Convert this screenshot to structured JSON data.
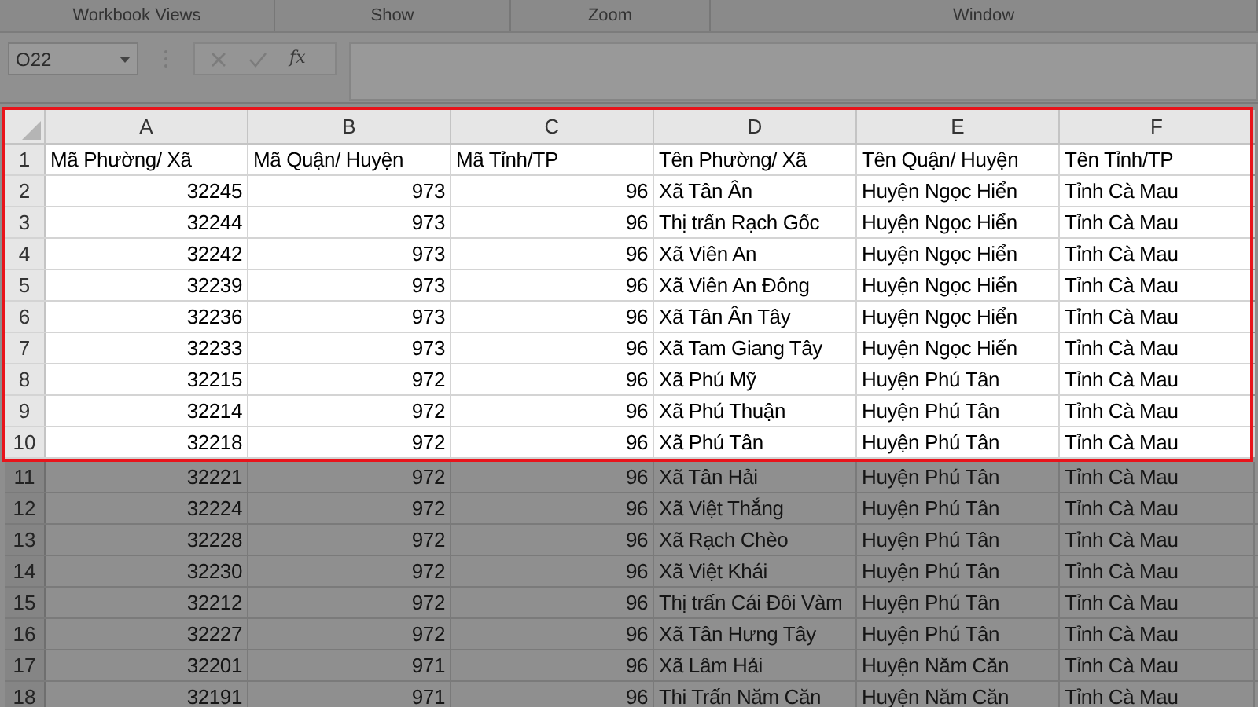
{
  "ribbon_groups": [
    "Workbook Views",
    "Show",
    "Zoom",
    "Window"
  ],
  "name_box": {
    "value": "O22"
  },
  "insert_function": "fx",
  "columns": [
    {
      "label": "A",
      "kind": "number"
    },
    {
      "label": "B",
      "kind": "number"
    },
    {
      "label": "C",
      "kind": "number"
    },
    {
      "label": "D",
      "kind": "text"
    },
    {
      "label": "E",
      "kind": "text"
    },
    {
      "label": "F",
      "kind": "text"
    }
  ],
  "rows": [
    {
      "number": "1",
      "kind": "header",
      "highlighted": true,
      "cells": [
        "Mã Phường/ Xã",
        "Mã Quận/ Huyện",
        "Mã Tỉnh/TP",
        "Tên Phường/ Xã",
        "Tên Quận/ Huyện",
        "Tên Tỉnh/TP"
      ]
    },
    {
      "number": "2",
      "kind": "data",
      "highlighted": true,
      "cells": [
        "32245",
        "973",
        "96",
        "Xã Tân Ân",
        "Huyện Ngọc Hiển",
        "Tỉnh Cà Mau"
      ]
    },
    {
      "number": "3",
      "kind": "data",
      "highlighted": true,
      "cells": [
        "32244",
        "973",
        "96",
        "Thị trấn Rạch Gốc",
        "Huyện Ngọc Hiển",
        "Tỉnh Cà Mau"
      ]
    },
    {
      "number": "4",
      "kind": "data",
      "highlighted": true,
      "cells": [
        "32242",
        "973",
        "96",
        "Xã Viên An",
        "Huyện Ngọc Hiển",
        "Tỉnh Cà Mau"
      ]
    },
    {
      "number": "5",
      "kind": "data",
      "highlighted": true,
      "cells": [
        "32239",
        "973",
        "96",
        "Xã Viên An Đông",
        "Huyện Ngọc Hiển",
        "Tỉnh Cà Mau"
      ]
    },
    {
      "number": "6",
      "kind": "data",
      "highlighted": true,
      "cells": [
        "32236",
        "973",
        "96",
        "Xã Tân Ân Tây",
        "Huyện Ngọc Hiển",
        "Tỉnh Cà Mau"
      ]
    },
    {
      "number": "7",
      "kind": "data",
      "highlighted": true,
      "cells": [
        "32233",
        "973",
        "96",
        "Xã Tam Giang Tây",
        "Huyện Ngọc Hiển",
        "Tỉnh Cà Mau"
      ]
    },
    {
      "number": "8",
      "kind": "data",
      "highlighted": true,
      "cells": [
        "32215",
        "972",
        "96",
        "Xã Phú Mỹ",
        "Huyện Phú Tân",
        "Tỉnh Cà Mau"
      ]
    },
    {
      "number": "9",
      "kind": "data",
      "highlighted": true,
      "cells": [
        "32214",
        "972",
        "96",
        "Xã Phú Thuận",
        "Huyện Phú Tân",
        "Tỉnh Cà Mau"
      ]
    },
    {
      "number": "10",
      "kind": "data",
      "highlighted": true,
      "cells": [
        "32218",
        "972",
        "96",
        "Xã Phú Tân",
        "Huyện Phú Tân",
        "Tỉnh Cà Mau"
      ]
    },
    {
      "number": "11",
      "kind": "data",
      "highlighted": false,
      "cells": [
        "32221",
        "972",
        "96",
        "Xã Tân Hải",
        "Huyện Phú Tân",
        "Tỉnh Cà Mau"
      ]
    },
    {
      "number": "12",
      "kind": "data",
      "highlighted": false,
      "cells": [
        "32224",
        "972",
        "96",
        "Xã Việt Thắng",
        "Huyện Phú Tân",
        "Tỉnh Cà Mau"
      ]
    },
    {
      "number": "13",
      "kind": "data",
      "highlighted": false,
      "cells": [
        "32228",
        "972",
        "96",
        "Xã Rạch Chèo",
        "Huyện Phú Tân",
        "Tỉnh Cà Mau"
      ]
    },
    {
      "number": "14",
      "kind": "data",
      "highlighted": false,
      "cells": [
        "32230",
        "972",
        "96",
        "Xã Việt Khái",
        "Huyện Phú Tân",
        "Tỉnh Cà Mau"
      ]
    },
    {
      "number": "15",
      "kind": "data",
      "highlighted": false,
      "cells": [
        "32212",
        "972",
        "96",
        "Thị trấn Cái Đôi Vàm",
        "Huyện Phú Tân",
        "Tỉnh Cà Mau"
      ]
    },
    {
      "number": "16",
      "kind": "data",
      "highlighted": false,
      "cells": [
        "32227",
        "972",
        "96",
        "Xã Tân Hưng Tây",
        "Huyện Phú Tân",
        "Tỉnh Cà Mau"
      ]
    },
    {
      "number": "17",
      "kind": "data",
      "highlighted": false,
      "cells": [
        "32201",
        "971",
        "96",
        "Xã Lâm Hải",
        "Huyện Năm Căn",
        "Tỉnh Cà Mau"
      ]
    },
    {
      "number": "18",
      "kind": "data",
      "highlighted": false,
      "cells": [
        "32191",
        "971",
        "96",
        "Thi Trấn Năm Căn",
        "Huyện Năm Căn",
        "Tỉnh Cà Mau"
      ]
    }
  ]
}
